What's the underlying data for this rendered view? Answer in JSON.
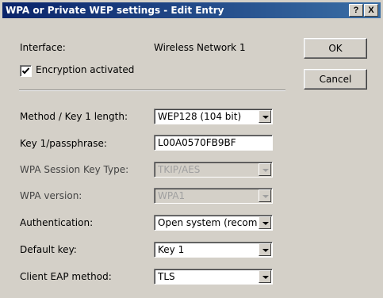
{
  "window": {
    "title": "WPA or Private WEP settings - Edit Entry",
    "help_button": "?",
    "close_button": "X"
  },
  "interface": {
    "label": "Interface:",
    "value": "Wireless Network 1"
  },
  "encryption": {
    "label": "Encryption activated",
    "checked": true
  },
  "buttons": {
    "ok": "OK",
    "cancel": "Cancel"
  },
  "fields": {
    "method": {
      "label": "Method / Key 1 length:",
      "value": "WEP128 (104 bit)"
    },
    "key": {
      "label": "Key 1/passphrase:",
      "value": "L00A0570FB9BF"
    },
    "session_key_type": {
      "label": "WPA Session Key Type:",
      "value": "TKIP/AES"
    },
    "wpa_version": {
      "label": "WPA version:",
      "value": "WPA1"
    },
    "authentication": {
      "label": "Authentication:",
      "value": "Open system (recom"
    },
    "default_key": {
      "label": "Default key:",
      "value": "Key 1"
    },
    "eap_method": {
      "label": "Client EAP method:",
      "value": "TLS"
    }
  }
}
